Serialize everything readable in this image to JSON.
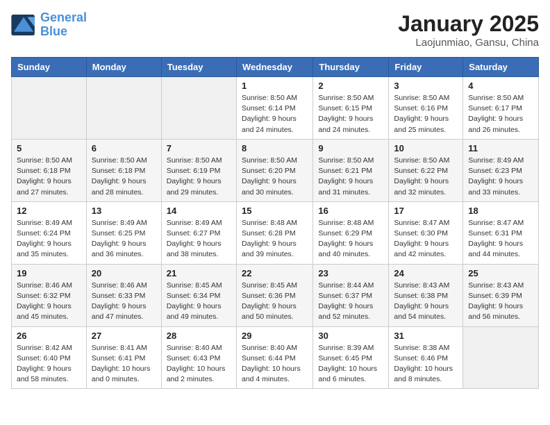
{
  "header": {
    "logo_line1": "General",
    "logo_line2": "Blue",
    "month_title": "January 2025",
    "location": "Laojunmiao, Gansu, China"
  },
  "days_of_week": [
    "Sunday",
    "Monday",
    "Tuesday",
    "Wednesday",
    "Thursday",
    "Friday",
    "Saturday"
  ],
  "weeks": [
    [
      {
        "day": "",
        "content": ""
      },
      {
        "day": "",
        "content": ""
      },
      {
        "day": "",
        "content": ""
      },
      {
        "day": "1",
        "content": "Sunrise: 8:50 AM\nSunset: 6:14 PM\nDaylight: 9 hours and 24 minutes."
      },
      {
        "day": "2",
        "content": "Sunrise: 8:50 AM\nSunset: 6:15 PM\nDaylight: 9 hours and 24 minutes."
      },
      {
        "day": "3",
        "content": "Sunrise: 8:50 AM\nSunset: 6:16 PM\nDaylight: 9 hours and 25 minutes."
      },
      {
        "day": "4",
        "content": "Sunrise: 8:50 AM\nSunset: 6:17 PM\nDaylight: 9 hours and 26 minutes."
      }
    ],
    [
      {
        "day": "5",
        "content": "Sunrise: 8:50 AM\nSunset: 6:18 PM\nDaylight: 9 hours and 27 minutes."
      },
      {
        "day": "6",
        "content": "Sunrise: 8:50 AM\nSunset: 6:18 PM\nDaylight: 9 hours and 28 minutes."
      },
      {
        "day": "7",
        "content": "Sunrise: 8:50 AM\nSunset: 6:19 PM\nDaylight: 9 hours and 29 minutes."
      },
      {
        "day": "8",
        "content": "Sunrise: 8:50 AM\nSunset: 6:20 PM\nDaylight: 9 hours and 30 minutes."
      },
      {
        "day": "9",
        "content": "Sunrise: 8:50 AM\nSunset: 6:21 PM\nDaylight: 9 hours and 31 minutes."
      },
      {
        "day": "10",
        "content": "Sunrise: 8:50 AM\nSunset: 6:22 PM\nDaylight: 9 hours and 32 minutes."
      },
      {
        "day": "11",
        "content": "Sunrise: 8:49 AM\nSunset: 6:23 PM\nDaylight: 9 hours and 33 minutes."
      }
    ],
    [
      {
        "day": "12",
        "content": "Sunrise: 8:49 AM\nSunset: 6:24 PM\nDaylight: 9 hours and 35 minutes."
      },
      {
        "day": "13",
        "content": "Sunrise: 8:49 AM\nSunset: 6:25 PM\nDaylight: 9 hours and 36 minutes."
      },
      {
        "day": "14",
        "content": "Sunrise: 8:49 AM\nSunset: 6:27 PM\nDaylight: 9 hours and 38 minutes."
      },
      {
        "day": "15",
        "content": "Sunrise: 8:48 AM\nSunset: 6:28 PM\nDaylight: 9 hours and 39 minutes."
      },
      {
        "day": "16",
        "content": "Sunrise: 8:48 AM\nSunset: 6:29 PM\nDaylight: 9 hours and 40 minutes."
      },
      {
        "day": "17",
        "content": "Sunrise: 8:47 AM\nSunset: 6:30 PM\nDaylight: 9 hours and 42 minutes."
      },
      {
        "day": "18",
        "content": "Sunrise: 8:47 AM\nSunset: 6:31 PM\nDaylight: 9 hours and 44 minutes."
      }
    ],
    [
      {
        "day": "19",
        "content": "Sunrise: 8:46 AM\nSunset: 6:32 PM\nDaylight: 9 hours and 45 minutes."
      },
      {
        "day": "20",
        "content": "Sunrise: 8:46 AM\nSunset: 6:33 PM\nDaylight: 9 hours and 47 minutes."
      },
      {
        "day": "21",
        "content": "Sunrise: 8:45 AM\nSunset: 6:34 PM\nDaylight: 9 hours and 49 minutes."
      },
      {
        "day": "22",
        "content": "Sunrise: 8:45 AM\nSunset: 6:36 PM\nDaylight: 9 hours and 50 minutes."
      },
      {
        "day": "23",
        "content": "Sunrise: 8:44 AM\nSunset: 6:37 PM\nDaylight: 9 hours and 52 minutes."
      },
      {
        "day": "24",
        "content": "Sunrise: 8:43 AM\nSunset: 6:38 PM\nDaylight: 9 hours and 54 minutes."
      },
      {
        "day": "25",
        "content": "Sunrise: 8:43 AM\nSunset: 6:39 PM\nDaylight: 9 hours and 56 minutes."
      }
    ],
    [
      {
        "day": "26",
        "content": "Sunrise: 8:42 AM\nSunset: 6:40 PM\nDaylight: 9 hours and 58 minutes."
      },
      {
        "day": "27",
        "content": "Sunrise: 8:41 AM\nSunset: 6:41 PM\nDaylight: 10 hours and 0 minutes."
      },
      {
        "day": "28",
        "content": "Sunrise: 8:40 AM\nSunset: 6:43 PM\nDaylight: 10 hours and 2 minutes."
      },
      {
        "day": "29",
        "content": "Sunrise: 8:40 AM\nSunset: 6:44 PM\nDaylight: 10 hours and 4 minutes."
      },
      {
        "day": "30",
        "content": "Sunrise: 8:39 AM\nSunset: 6:45 PM\nDaylight: 10 hours and 6 minutes."
      },
      {
        "day": "31",
        "content": "Sunrise: 8:38 AM\nSunset: 6:46 PM\nDaylight: 10 hours and 8 minutes."
      },
      {
        "day": "",
        "content": ""
      }
    ]
  ]
}
